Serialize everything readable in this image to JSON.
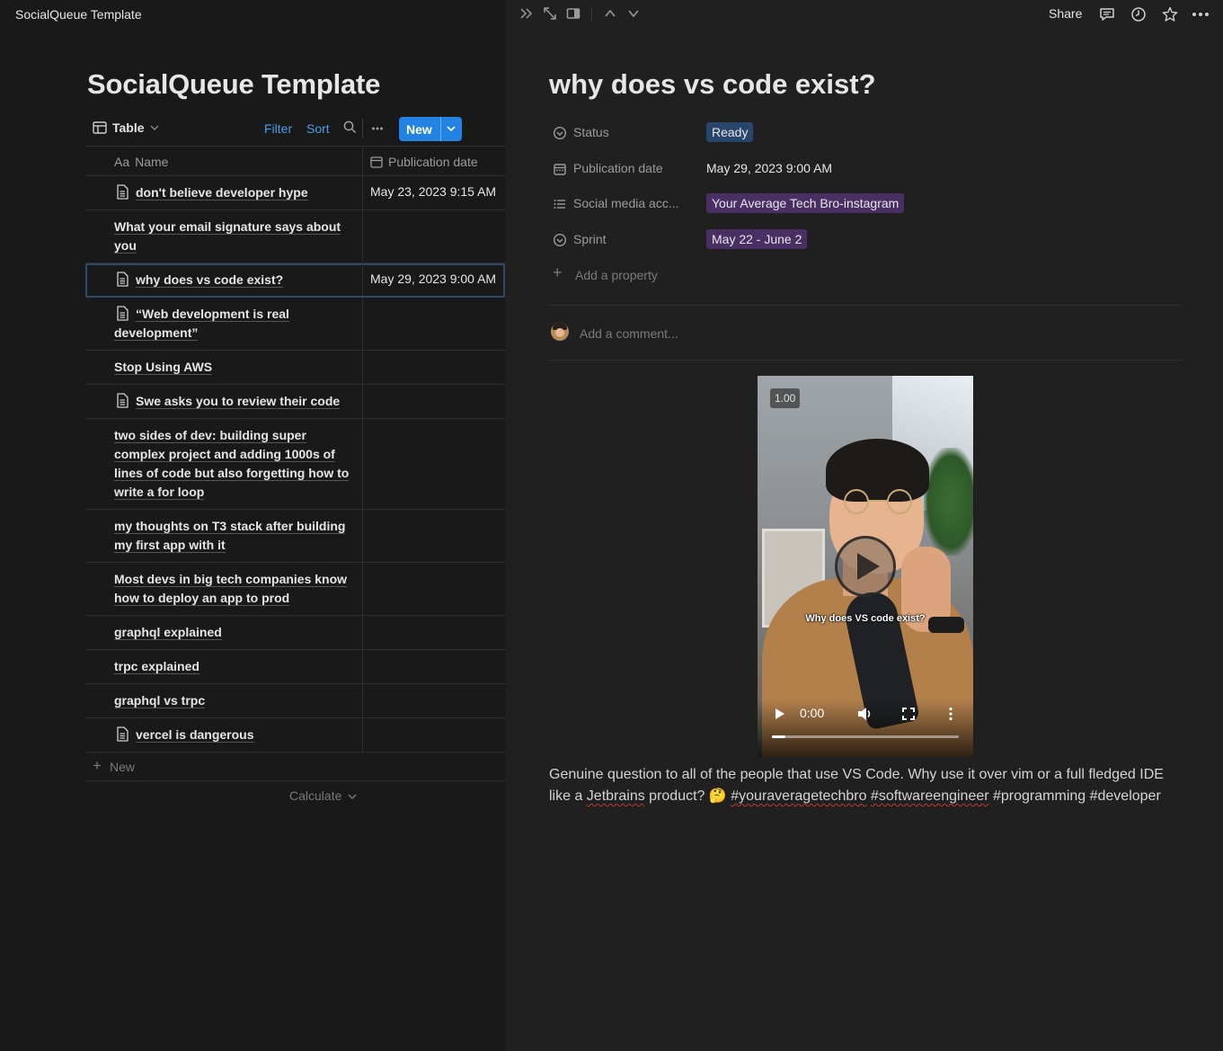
{
  "app": {
    "window_title": "SocialQueue Template"
  },
  "database": {
    "title": "SocialQueue Template",
    "view_label": "Table",
    "filter_label": "Filter",
    "sort_label": "Sort",
    "new_label": "New",
    "columns": {
      "name": "Name",
      "name_prefix": "Aa",
      "publication_date": "Publication date"
    },
    "rows": [
      {
        "name": "don't believe developer hype",
        "date": "May 23, 2023 9:15 AM",
        "icon": "page-icon"
      },
      {
        "name": "What your email signature says about you",
        "date": "",
        "icon": ""
      },
      {
        "name": "why does vs code exist?",
        "date": "May 29, 2023 9:00 AM",
        "icon": "page-icon",
        "selected": true
      },
      {
        "name": "“Web development is real development”",
        "date": "",
        "icon": "page-icon"
      },
      {
        "name": "Stop Using AWS",
        "date": "",
        "icon": ""
      },
      {
        "name": "Swe asks you to review their code",
        "date": "",
        "icon": "page-icon"
      },
      {
        "name": "two sides of dev: building super complex project and adding 1000s of lines of code but also forgetting how to write a for loop",
        "date": "",
        "icon": ""
      },
      {
        "name": "my thoughts on T3 stack after building my first app with it",
        "date": "",
        "icon": ""
      },
      {
        "name": "Most devs in big tech companies know how to deploy an app to prod",
        "date": "",
        "icon": ""
      },
      {
        "name": "graphql explained",
        "date": "",
        "icon": ""
      },
      {
        "name": "trpc explained",
        "date": "",
        "icon": ""
      },
      {
        "name": "graphql vs trpc",
        "date": "",
        "icon": ""
      },
      {
        "name": "vercel is dangerous",
        "date": "",
        "icon": "page-icon"
      }
    ],
    "add_row_label": "New",
    "calculate_label": "Calculate"
  },
  "topbar": {
    "share_label": "Share"
  },
  "page": {
    "title": "why does vs code exist?",
    "properties": {
      "status": {
        "label": "Status",
        "value": "Ready",
        "color": "#28456c"
      },
      "publication_date": {
        "label": "Publication date",
        "value": "May 29, 2023 9:00 AM"
      },
      "social_media": {
        "label": "Social media acc...",
        "value": "Your Average Tech Bro-instagram",
        "color": "#492f64"
      },
      "sprint": {
        "label": "Sprint",
        "value": "May 22 - June 2",
        "color": "#492f64"
      }
    },
    "add_property_label": "Add a property",
    "comment_placeholder": "Add a comment...",
    "video": {
      "speed_badge": "1.00",
      "caption": "Why does VS code exist?",
      "current_time": "0:00",
      "progress_fraction": 0.07
    },
    "body": {
      "text1": "Genuine question to all of the people that use VS Code. Why use it over vim or a full fledged IDE like a ",
      "jetbrains": "Jetbrains",
      "text2": " product? 🤔  ",
      "hashtag1": "#youraveragetechbro",
      "space": " ",
      "hashtag2": "#softwareengineer",
      "text3": " #programming #developer"
    }
  }
}
